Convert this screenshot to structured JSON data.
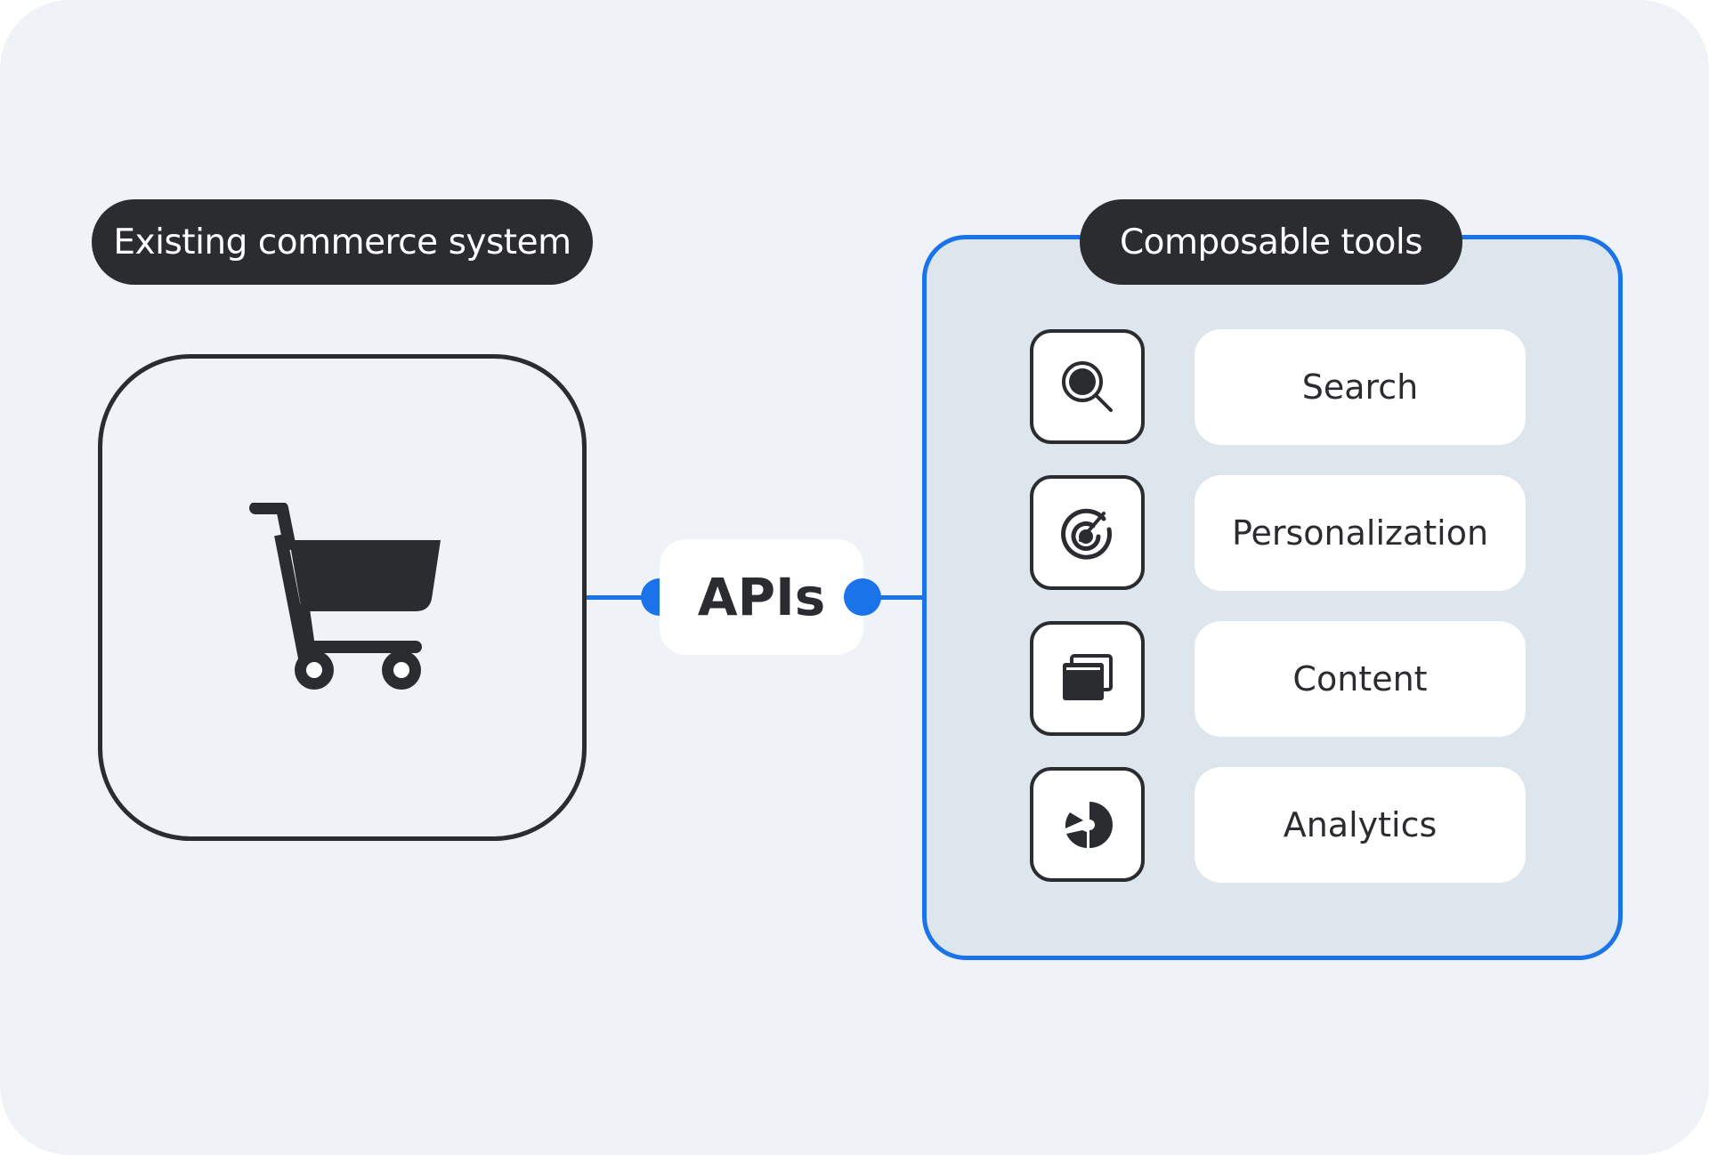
{
  "left": {
    "title": "Existing commerce system",
    "icon": "shopping-cart-icon"
  },
  "connector": {
    "label": "APIs",
    "color": "#1a73e8"
  },
  "right": {
    "title": "Composable tools",
    "tools": [
      {
        "label": "Search",
        "icon": "search-icon"
      },
      {
        "label": "Personalization",
        "icon": "target-icon"
      },
      {
        "label": "Content",
        "icon": "windows-icon"
      },
      {
        "label": "Analytics",
        "icon": "pie-chart-icon"
      }
    ]
  },
  "colors": {
    "background": "#eff2f6",
    "panel": "#dde5ed",
    "accent": "#1a73e8",
    "dark": "#2b2c30"
  }
}
